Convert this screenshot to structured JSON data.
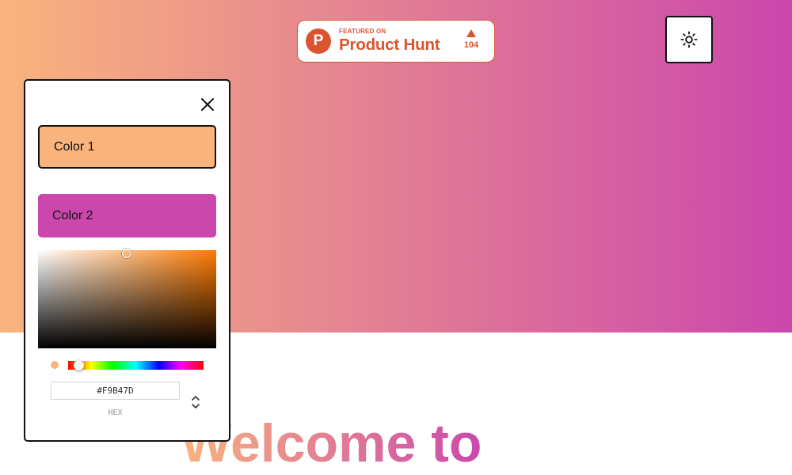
{
  "colors": {
    "color1": "#F9B47D",
    "color2": "#CB47AC",
    "hue_base": "#FF7A00",
    "badge_accent": "#DA552F"
  },
  "product_hunt": {
    "icon": "product-hunt-logo",
    "logo_letter": "P",
    "featured_label": "FEATURED ON",
    "name": "Product Hunt",
    "vote_icon": "upvote-arrow-icon",
    "votes": "104"
  },
  "header": {
    "theme_toggle_icon": "sun-icon"
  },
  "hero": {
    "welcome_text": "Welcome to"
  },
  "color_panel": {
    "close_icon": "close-icon",
    "color1_label": "Color 1",
    "color2_label": "Color 2",
    "picker": {
      "hex_value": "#F9B47D",
      "format_label": "HEX",
      "format_toggle_icon": "chevron-up-down-icon",
      "hue_fraction": 0.07,
      "saturation_fraction": 0.5,
      "value_fraction": 0.98
    }
  }
}
